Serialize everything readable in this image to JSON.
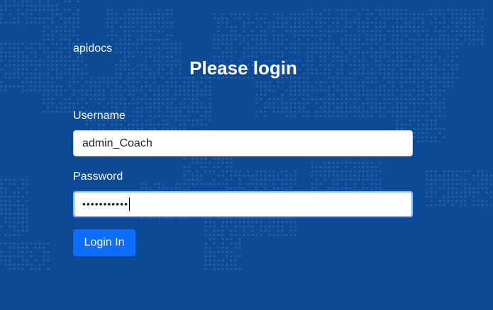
{
  "brand": "apidocs",
  "title": "Please login",
  "form": {
    "username_label": "Username",
    "username_value": "admin_Coach",
    "password_label": "Password",
    "password_masked": "•••••••••••",
    "submit_label": "Login In"
  },
  "colors": {
    "background": "#0c4a96",
    "map_dots": "#3a73b8",
    "button": "#0d6efd",
    "focus_border": "#86b7fe"
  }
}
